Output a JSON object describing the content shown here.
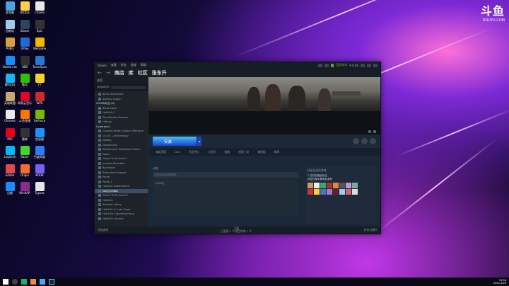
{
  "watermark": {
    "logo": "斗鱼",
    "url": "DOUYU.COM"
  },
  "desktop_icons": [
    {
      "label": "此电脑",
      "color": "#4aa3df"
    },
    {
      "label": "QQ音乐",
      "color": "#ffd23f"
    },
    {
      "label": "ChaoSi",
      "color": "#e8e8e8"
    },
    {
      "label": "回收站",
      "color": "#9ecbe8"
    },
    {
      "label": "Steam",
      "color": "#2a475e"
    },
    {
      "label": "Epic",
      "color": "#333"
    },
    {
      "label": "PUBG",
      "color": "#d8a23a"
    },
    {
      "label": "UPlay",
      "color": "#1e6ad6"
    },
    {
      "label": "WeGame",
      "color": "#f2b600"
    },
    {
      "label": "Battle.net",
      "color": "#148eff"
    },
    {
      "label": "OBS",
      "color": "#302e31"
    },
    {
      "label": "TeamSpeak",
      "color": "#2b78d0"
    },
    {
      "label": "腾讯QQ",
      "color": "#12b7f5"
    },
    {
      "label": "微信",
      "color": "#2dc100"
    },
    {
      "label": "YY",
      "color": "#f5d02b"
    },
    {
      "label": "英雄联盟",
      "color": "#c8aa6e"
    },
    {
      "label": "网易云音乐",
      "color": "#e60026"
    },
    {
      "label": "WPS",
      "color": "#d0292b"
    },
    {
      "label": "Chrome",
      "color": "#e9e9e9"
    },
    {
      "label": "斗鱼直播",
      "color": "#ff7700"
    },
    {
      "label": "GeForce",
      "color": "#76b900"
    },
    {
      "label": "MSI",
      "color": "#e50012"
    },
    {
      "label": "雷神",
      "color": "#333"
    },
    {
      "label": "加速器",
      "color": "#1e90ff"
    },
    {
      "label": "Logitech",
      "color": "#00b8fc"
    },
    {
      "label": "Razer",
      "color": "#44d62c"
    },
    {
      "label": "百度网盘",
      "color": "#2e7cf6"
    },
    {
      "label": "Adobe",
      "color": "#e34850"
    },
    {
      "label": "Origin",
      "color": "#f56c2d"
    },
    {
      "label": "KOOK",
      "color": "#7a5cff"
    },
    {
      "label": "迅雷",
      "color": "#1a8cff"
    },
    {
      "label": "WinRAR",
      "color": "#8a2b8f"
    },
    {
      "label": "Typora",
      "color": "#e6e6e6"
    }
  ],
  "window": {
    "menu": [
      "Steam",
      "查看",
      "好友",
      "游戏",
      "帮助"
    ],
    "user": "蓝鲸游戏",
    "wallet": "¥ 0.00",
    "nav": {
      "store": "商店",
      "library": "库",
      "community": "社区",
      "user": "张东升"
    },
    "sidebar": {
      "home": "主页",
      "filter": "游戏和软件",
      "items": [
        {
          "label": "Sonic Adventure",
          "kind": "game"
        },
        {
          "label": "Sparkly Legion",
          "kind": "game"
        },
        {
          "label": "2020年玩过 (6)",
          "kind": "section"
        },
        {
          "label": "Black Mesa",
          "kind": "game"
        },
        {
          "label": "Half-Life 2",
          "kind": "game"
        },
        {
          "label": "The Stanley Parable",
          "kind": "game"
        },
        {
          "label": "Hitman",
          "kind": "game"
        },
        {
          "label": "Cyberpunk",
          "kind": "section"
        },
        {
          "label": "Counter-Strike: Global Offensive",
          "kind": "game"
        },
        {
          "label": "CS:GO - Anniversary",
          "kind": "game"
        },
        {
          "label": "Deadly",
          "kind": "game"
        },
        {
          "label": "Dishonored",
          "kind": "game"
        },
        {
          "label": "Dishonored: Definitive Edition",
          "kind": "game"
        },
        {
          "label": "Doom",
          "kind": "game"
        },
        {
          "label": "Grand Theft Auto V",
          "kind": "game"
        },
        {
          "label": "Jurassic Evolution",
          "kind": "game"
        },
        {
          "label": "Bad North",
          "kind": "game"
        },
        {
          "label": "Enter the Gungeon",
          "kind": "game"
        },
        {
          "label": "Portal",
          "kind": "game"
        },
        {
          "label": "Portal 2",
          "kind": "game"
        },
        {
          "label": "Half-Life Deathmatch",
          "kind": "game"
        },
        {
          "label": "Garry's Mod",
          "kind": "game"
        },
        {
          "label": "Grand Theft Auto IV",
          "kind": "game"
        },
        {
          "label": "Half-Life",
          "kind": "game"
        },
        {
          "label": "Stardew Valley",
          "kind": "game"
        },
        {
          "label": "Half-Life 2: Lost Coast",
          "kind": "game"
        },
        {
          "label": "Half-Life: Opposing Force",
          "kind": "game"
        },
        {
          "label": "Half-Life: Source",
          "kind": "game"
        }
      ],
      "selected_index": 21,
      "add_game": "添加游戏"
    },
    "play_label": "安装",
    "tabs": [
      "商店页面",
      "DLC",
      "社区中心",
      "讨论区",
      "指南",
      "创意工坊",
      "查找组",
      "新闻"
    ],
    "activity": {
      "title": "动态",
      "placeholder": "发表对此游戏的看法…",
      "sub": "1月25日"
    },
    "friends": {
      "title": "好友在玩的游戏",
      "line1": "1 位好友最近玩过",
      "line2": "好友在库中拥有此游戏"
    },
    "downloads": {
      "title": "下载",
      "status": "已暂停 1 个项目中的 1 个"
    },
    "friends_chat": "好友与聊天"
  },
  "taskbar": {
    "time": "19:56",
    "date": "2021/1/26"
  }
}
